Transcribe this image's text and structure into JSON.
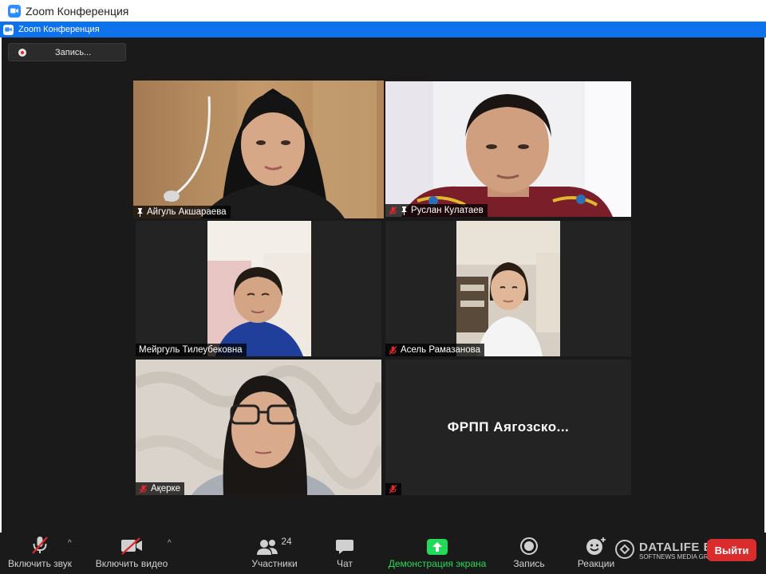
{
  "app": {
    "title": "Zoom Конференция"
  },
  "meeting_bar": {
    "title": "Zoom Конференция"
  },
  "recording": {
    "label": "Запись..."
  },
  "participants": [
    {
      "name": "Айгуль Акшараева",
      "pinned": true,
      "muted": false,
      "active_speaker": true
    },
    {
      "name": "Руслан Кулатаев",
      "pinned": true,
      "muted": true
    },
    {
      "name": "Мейргуль Тилеубековна",
      "pinned": false,
      "muted": false
    },
    {
      "name": "Асель Рамазанова",
      "pinned": false,
      "muted": true
    },
    {
      "name": "Ақерке",
      "pinned": false,
      "muted": true
    },
    {
      "name": "",
      "display_text": "ФРПП  Аягозско...",
      "muted": true
    }
  ],
  "toolbar": {
    "unmute_label": "Включить звук",
    "video_label": "Включить видео",
    "participants_label": "Участники",
    "participants_count": "24",
    "chat_label": "Чат",
    "share_label": "Демонстрация экрана",
    "record_label": "Запись",
    "reactions_label": "Реакции",
    "leave_label": "Выйти"
  },
  "watermark": {
    "main": "DATALIFE ENGINE",
    "sub": "SOFTNEWS MEDIA GROUP"
  },
  "colors": {
    "accent": "#0e72ed",
    "active_border": "#c4e25c",
    "share_green": "#23d959",
    "leave_red": "#d92d2d",
    "muted_red": "#e02828"
  }
}
